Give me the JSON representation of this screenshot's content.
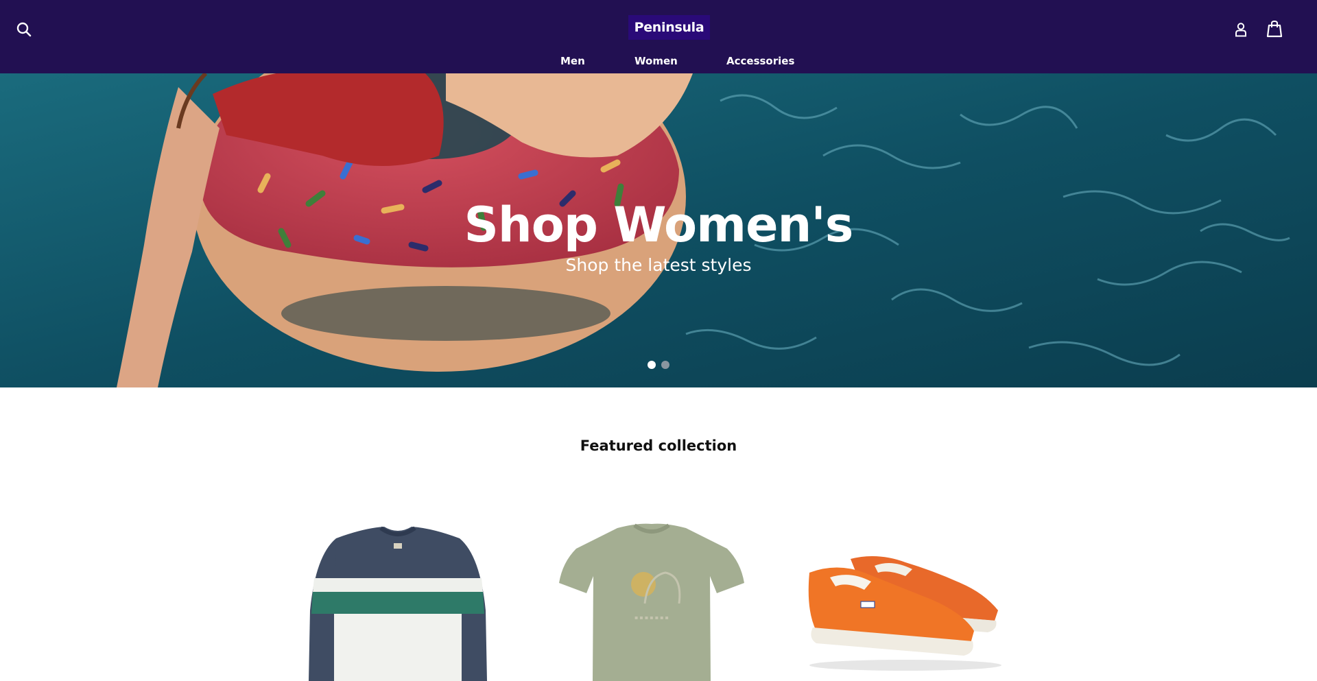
{
  "header": {
    "logo_text": "Peninsula",
    "icons": {
      "search": "search-icon",
      "account": "user-icon",
      "cart": "shopping-bag-icon"
    },
    "nav": [
      {
        "label": "Men"
      },
      {
        "label": "Women"
      },
      {
        "label": "Accessories"
      }
    ],
    "colors": {
      "background": "#221052",
      "logo_bg": "#2a0a78"
    }
  },
  "hero": {
    "title": "Shop Women's",
    "subtitle": "Shop the latest styles",
    "slide_count": 2,
    "active_slide": 1,
    "image": "woman-on-donut-float-in-pool"
  },
  "featured": {
    "title": "Featured collection",
    "products": [
      {
        "image": "colorblock-crewneck-sweater"
      },
      {
        "image": "sage-graphic-tshirt"
      },
      {
        "image": "orange-slip-on-sneakers"
      }
    ]
  }
}
